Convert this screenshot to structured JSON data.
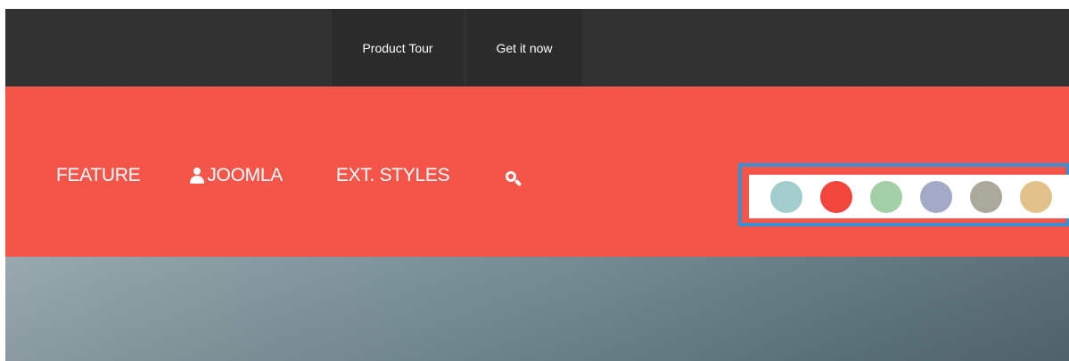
{
  "topnav": {
    "items": [
      {
        "label": "Product Tour"
      },
      {
        "label": "Get it now"
      }
    ]
  },
  "mainnav": {
    "items": [
      {
        "label": "FEATURE"
      },
      {
        "label": "JOOMLA",
        "icon": "user-icon"
      },
      {
        "label": "EXT. STYLES"
      }
    ],
    "search_icon": "search-icon"
  },
  "style_switcher": {
    "swatches": [
      {
        "name": "teal",
        "color": "#a3cdcc"
      },
      {
        "name": "red",
        "color": "#f2463d"
      },
      {
        "name": "green",
        "color": "#a2cfa5"
      },
      {
        "name": "blue-grey",
        "color": "#a2aac8"
      },
      {
        "name": "grey",
        "color": "#aba89c"
      },
      {
        "name": "sand",
        "color": "#e2c28a"
      }
    ]
  },
  "colors": {
    "topbar": "#323232",
    "mainbar": "#f55449",
    "highlight": "#3a8fd0"
  }
}
